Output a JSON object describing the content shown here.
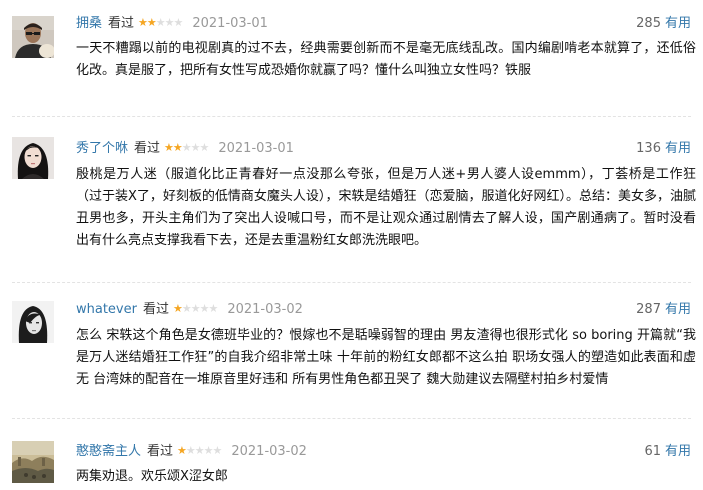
{
  "reviews": [
    {
      "username": "拥桑",
      "status": "看过",
      "rating": 2,
      "date": "2021-03-01",
      "votes": "285",
      "vote_label": "有用",
      "content": "一天不糟蹋以前的电视剧真的过不去，经典需要创新而不是毫无底线乱改。国内编剧啃老本就算了，还低俗化改。真是服了，把所有女性写成恐婚你就赢了吗？懂什么叫独立女性吗？铁服"
    },
    {
      "username": "秀了个咻",
      "status": "看过",
      "rating": 2,
      "date": "2021-03-01",
      "votes": "136",
      "vote_label": "有用",
      "content": "殷桃是万人迷（服道化比正青春好一点没那么夸张，但是万人迷+男人婆人设emmm），丁荟桥是工作狂（过于装X了，好刻板的低情商女魔头人设），宋轶是结婚狂（恋爱脑，服道化好网红）。总结：美女多，油腻丑男也多，开头主角们为了突出人设喊口号，而不是让观众通过剧情去了解人设，国产剧通病了。暂时没看出有什么亮点支撑我看下去，还是去重温粉红女郎洗洗眼吧。"
    },
    {
      "username": "whatever",
      "status": "看过",
      "rating": 1,
      "date": "2021-03-02",
      "votes": "287",
      "vote_label": "有用",
      "content": "怎么 宋轶这个角色是女德班毕业的？恨嫁也不是聒噪弱智的理由 男友渣得也很形式化 so boring 开篇就“我是万人迷结婚狂工作狂”的自我介绍非常土味 十年前的粉红女郎都不这么拍 职场女强人的塑造如此表面和虚无 台湾妹的配音在一堆原音里好违和 所有男性角色都丑哭了 魏大勋建议去隔壁村拍乡村爱情"
    },
    {
      "username": "憨憨斋主人",
      "status": "看过",
      "rating": 1,
      "date": "2021-03-02",
      "votes": "61",
      "vote_label": "有用",
      "content": "两集劝退。欢乐颂X涩女郎"
    }
  ],
  "colors": {
    "link": "#3377aa",
    "star_on": "#f5a623",
    "star_off": "#dedede",
    "date": "#999999"
  },
  "icons": {
    "avatar_1": "avatar-man-glasses",
    "avatar_2": "avatar-woman-portrait",
    "avatar_3": "avatar-woman-bw",
    "avatar_4": "avatar-landscape-painting"
  }
}
